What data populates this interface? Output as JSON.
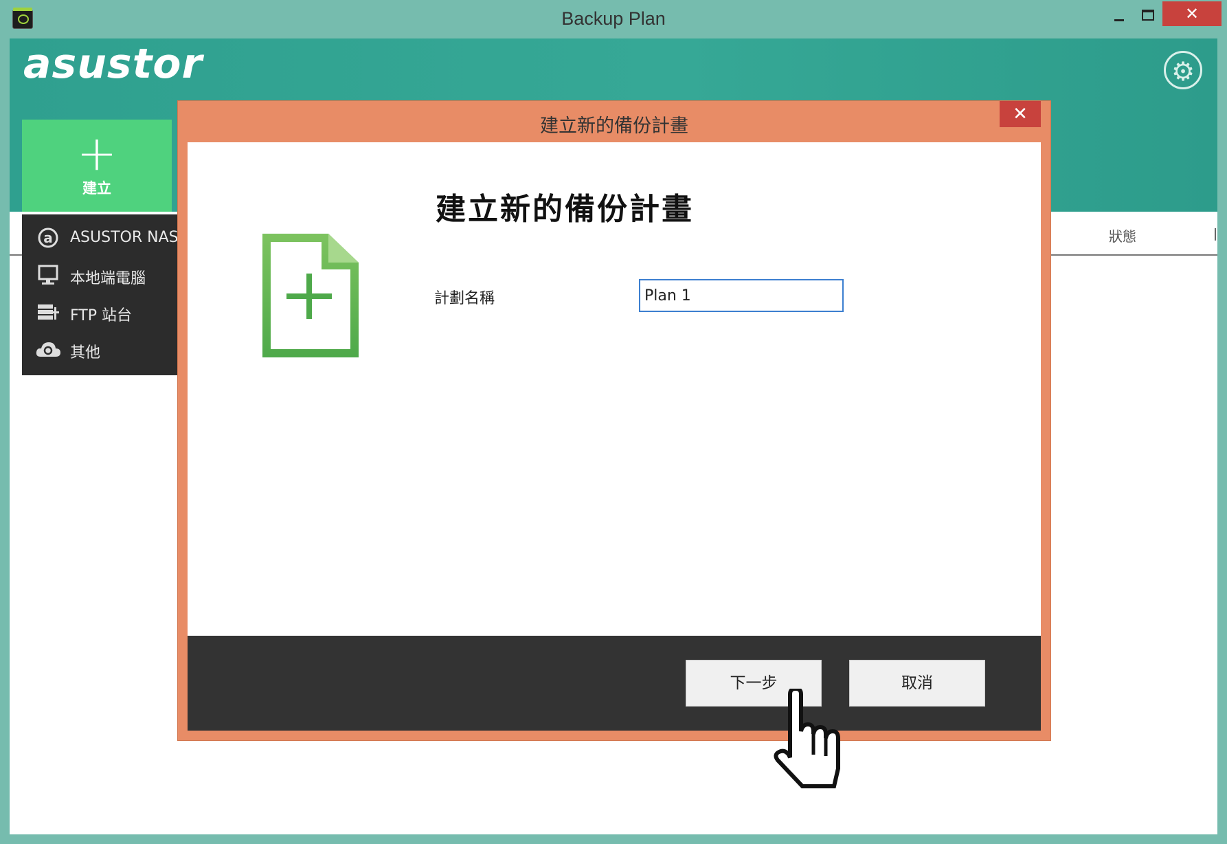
{
  "window": {
    "title": "Backup Plan",
    "controls": {
      "minimize": "minimize-icon",
      "maximize": "maximize-icon",
      "close": "✕"
    }
  },
  "header": {
    "logo": "asustor",
    "settings_icon": "gear-icon",
    "create_button": {
      "icon": "+",
      "label": "建立"
    }
  },
  "menu": {
    "items": [
      {
        "icon": "asustor-logo-icon",
        "label": "ASUSTOR NAS"
      },
      {
        "icon": "monitor-icon",
        "label": "本地端電腦"
      },
      {
        "icon": "ftp-server-icon",
        "label": "FTP 站台"
      },
      {
        "icon": "cloud-icon",
        "label": "其他"
      }
    ]
  },
  "table": {
    "columns": {
      "status": "狀態"
    }
  },
  "dialog": {
    "title": "建立新的備份計畫",
    "close": "✕",
    "heading": "建立新的備份計畫",
    "icon": "new-document-icon",
    "fields": {
      "plan_name": {
        "label": "計劃名稱",
        "value": "Plan 1"
      }
    },
    "buttons": {
      "next": "下一步",
      "cancel": "取消"
    }
  },
  "colors": {
    "window_frame": "#76bcae",
    "header": "#36a896",
    "create_button": "#4fd27e",
    "dialog_frame": "#e88c66",
    "dialog_footer": "#333333",
    "close_button": "#c8423d",
    "input_focus": "#3c7fd0"
  }
}
